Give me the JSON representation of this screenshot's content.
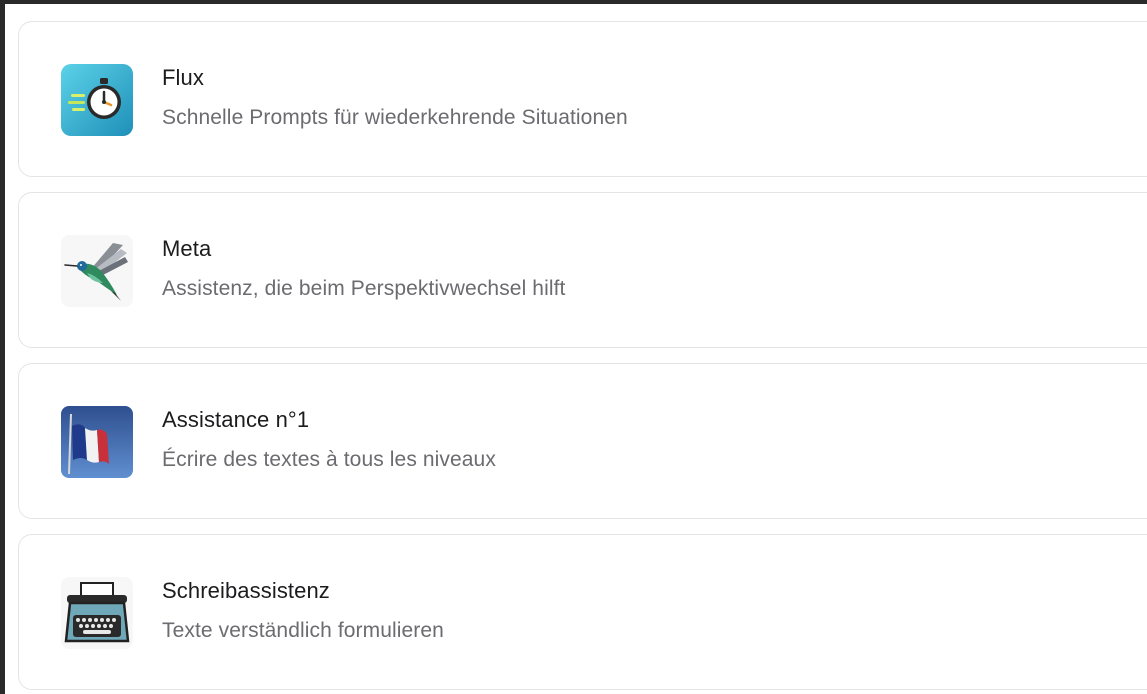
{
  "assistants": [
    {
      "title": "Flux",
      "subtitle": "Schnelle Prompts für wiederkehrende Situationen",
      "icon": "stopwatch-icon"
    },
    {
      "title": "Meta",
      "subtitle": "Assistenz, die beim Perspektivwechsel hilft",
      "icon": "hummingbird-icon"
    },
    {
      "title": "Assistance n°1",
      "subtitle": "Écrire des textes à tous les niveaux",
      "icon": "french-flag-icon"
    },
    {
      "title": "Schreibassistenz",
      "subtitle": "Texte verständlich formulieren",
      "icon": "typewriter-icon"
    }
  ],
  "colors": {
    "card_border": "#e4e4e7",
    "title": "#1c1c1e",
    "subtitle": "#6b6b70",
    "flux_icon_bg": "#2fb3d6"
  }
}
